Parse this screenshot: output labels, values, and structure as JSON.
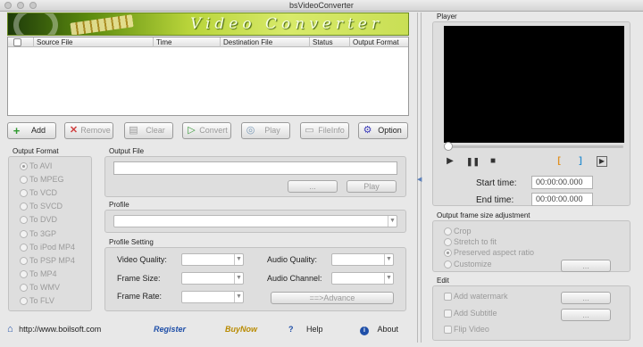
{
  "window": {
    "title": "bsVideoConverter"
  },
  "banner": {
    "text": "Video Converter"
  },
  "file_table": {
    "columns": [
      "Source File",
      "Time",
      "Destination File",
      "Status",
      "Output Format"
    ],
    "rows": []
  },
  "toolbar": {
    "add": "Add",
    "remove": "Remove",
    "clear": "Clear",
    "convert": "Convert",
    "play": "Play",
    "fileinfo": "FileInfo",
    "option": "Option"
  },
  "output_format": {
    "label": "Output Format",
    "options": [
      "To AVI",
      "To MPEG",
      "To VCD",
      "To SVCD",
      "To DVD",
      "To 3GP",
      "To iPod MP4",
      "To PSP MP4",
      "To MP4",
      "To WMV",
      "To FLV"
    ],
    "selected": "To AVI"
  },
  "output_file": {
    "label": "Output File",
    "value": "",
    "browse": "...",
    "play": "Play"
  },
  "profile": {
    "label": "Profile",
    "value": ""
  },
  "profile_setting": {
    "label": "Profile Setting",
    "video_quality": "Video Quality:",
    "audio_quality": "Audio Quality:",
    "frame_size": "Frame Size:",
    "audio_channel": "Audio Channel:",
    "frame_rate": "Frame Rate:",
    "advance": "==>Advance"
  },
  "footer": {
    "url": "http://www.boilsoft.com",
    "register": "Register",
    "buy": "BuyNow",
    "help": "Help",
    "about": "About"
  },
  "player": {
    "label": "Player",
    "position": 0,
    "start_label": "Start time:",
    "start_value": "00:00:00.000",
    "end_label": "End time:",
    "end_value": "00:00:00.000"
  },
  "frame_adjust": {
    "label": "Output frame size adjustment",
    "options": [
      "Crop",
      "Stretch to fit",
      "Preserved aspect ratio",
      "Customize"
    ],
    "selected": "Preserved aspect ratio",
    "customize_btn": "..."
  },
  "edit": {
    "label": "Edit",
    "watermark": "Add watermark",
    "subtitle": "Add Subtitle",
    "flip": "Flip Video",
    "btn": "..."
  },
  "colors": {
    "banner": "#b8d43a",
    "video": "#000000",
    "buy": "#e8a800",
    "register": "#1f4fa8"
  }
}
